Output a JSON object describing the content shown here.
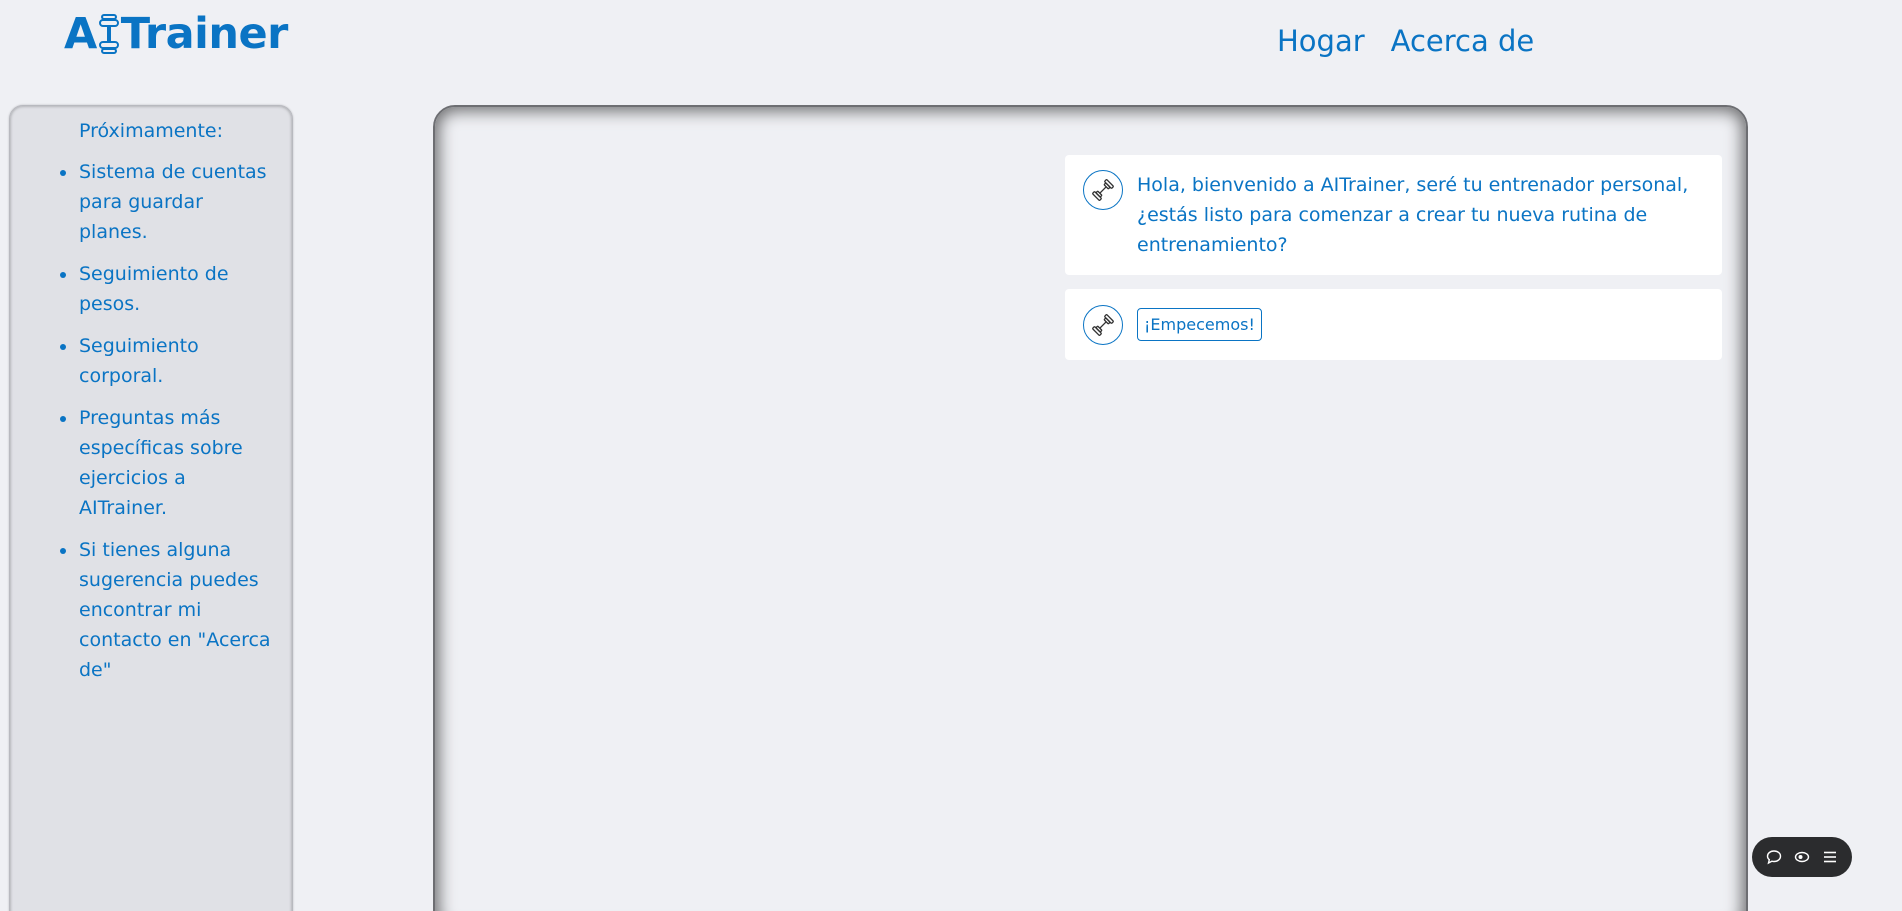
{
  "header": {
    "logo_prefix": "A",
    "logo_suffix": "Trainer",
    "nav": [
      {
        "label": "Hogar"
      },
      {
        "label": "Acerca de"
      }
    ]
  },
  "sidebar": {
    "title": "Próximamente:",
    "items": [
      {
        "label": "Sistema de cuentas para guardar planes."
      },
      {
        "label": "Seguimiento de pesos."
      },
      {
        "label": "Seguimiento corporal."
      },
      {
        "label": "Preguntas más específicas sobre ejercicios a AITrainer."
      },
      {
        "label": "Si tienes alguna sugerencia puedes encontrar mi contacto en \"Acerca de\""
      }
    ]
  },
  "chat": {
    "messages": [
      {
        "text": "Hola, bienvenido a AITrainer, seré tu entrenador personal, ¿estás listo para comenzar a crear tu nueva rutina de entrenamiento?",
        "avatar_icon": "dumbbell-icon"
      },
      {
        "button_label": "¡Empecemos!",
        "avatar_icon": "dumbbell-icon"
      }
    ]
  },
  "widget": {
    "icons": [
      "chat-bubble-icon",
      "eye-icon",
      "menu-icon"
    ]
  },
  "colors": {
    "accent": "#0a74c4",
    "background": "#eff0f4",
    "sidebar_bg": "#e0e1e6",
    "widget_bg": "#2b2c2e"
  }
}
